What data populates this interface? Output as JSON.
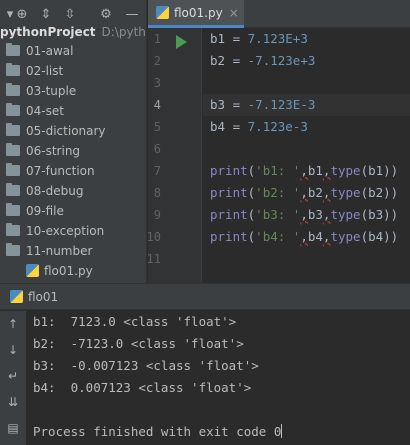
{
  "project": {
    "root_name": "pythonProject",
    "root_path": "D:\\python",
    "folders": [
      "01-awal",
      "02-list",
      "03-tuple",
      "04-set",
      "05-dictionary",
      "06-string",
      "07-function",
      "08-debug",
      "09-file",
      "10-exception",
      "11-number"
    ],
    "file": "flo01.py",
    "toolbar_icons": [
      "collapse-icon",
      "locate-icon",
      "expand-all-icon",
      "collapse-all-icon",
      "gear-icon",
      "minimize-icon"
    ]
  },
  "editor": {
    "tab_label": "flo01.py",
    "tab_close": "×",
    "line_numbers": [
      "1",
      "2",
      "3",
      "4",
      "5",
      "6",
      "7",
      "8",
      "9",
      "10",
      "11"
    ],
    "current_line": 4,
    "lines": [
      {
        "var": "b1",
        "op": " = ",
        "num": "7.123E+3"
      },
      {
        "var": "b2",
        "op": " = ",
        "num": "-7.123e+3"
      },
      {},
      {
        "var": "b3",
        "op": " = ",
        "num": "-7.123E-3"
      },
      {
        "var": "b4",
        "op": " = ",
        "num": "7.123e-3"
      },
      {},
      {
        "fn": "print",
        "open": "(",
        "str": "'b1: '",
        "sep1": ",",
        "arg": "b1",
        "sep2": ",",
        "fn2": "type",
        "rest": "(b1))"
      },
      {
        "fn": "print",
        "open": "(",
        "str": "'b2: '",
        "sep1": ",",
        "arg": "b2",
        "sep2": ",",
        "fn2": "type",
        "rest": "(b2))"
      },
      {
        "fn": "print",
        "open": "(",
        "str": "'b3: '",
        "sep1": ",",
        "arg": "b3",
        "sep2": ",",
        "fn2": "type",
        "rest": "(b3))"
      },
      {
        "fn": "print",
        "open": "(",
        "str": "'b4: '",
        "sep1": ",",
        "arg": "b4",
        "sep2": ",",
        "fn2": "type",
        "rest": "(b4))"
      }
    ]
  },
  "run": {
    "tab_label": "flo01",
    "tab_close": "×",
    "output": [
      "b1:  7123.0 <class 'float'>",
      "b2:  -7123.0 <class 'float'>",
      "b3:  -0.007123 <class 'float'>",
      "b4:  0.007123 <class 'float'>",
      "",
      "Process finished with exit code 0"
    ]
  },
  "colors": {
    "background": "#2b2b2b",
    "panel": "#3c3f41",
    "number": "#6897bb",
    "builtin": "#8888c6",
    "string": "#6a8759",
    "run_green": "#499c54",
    "accent": "#4a88c7"
  }
}
